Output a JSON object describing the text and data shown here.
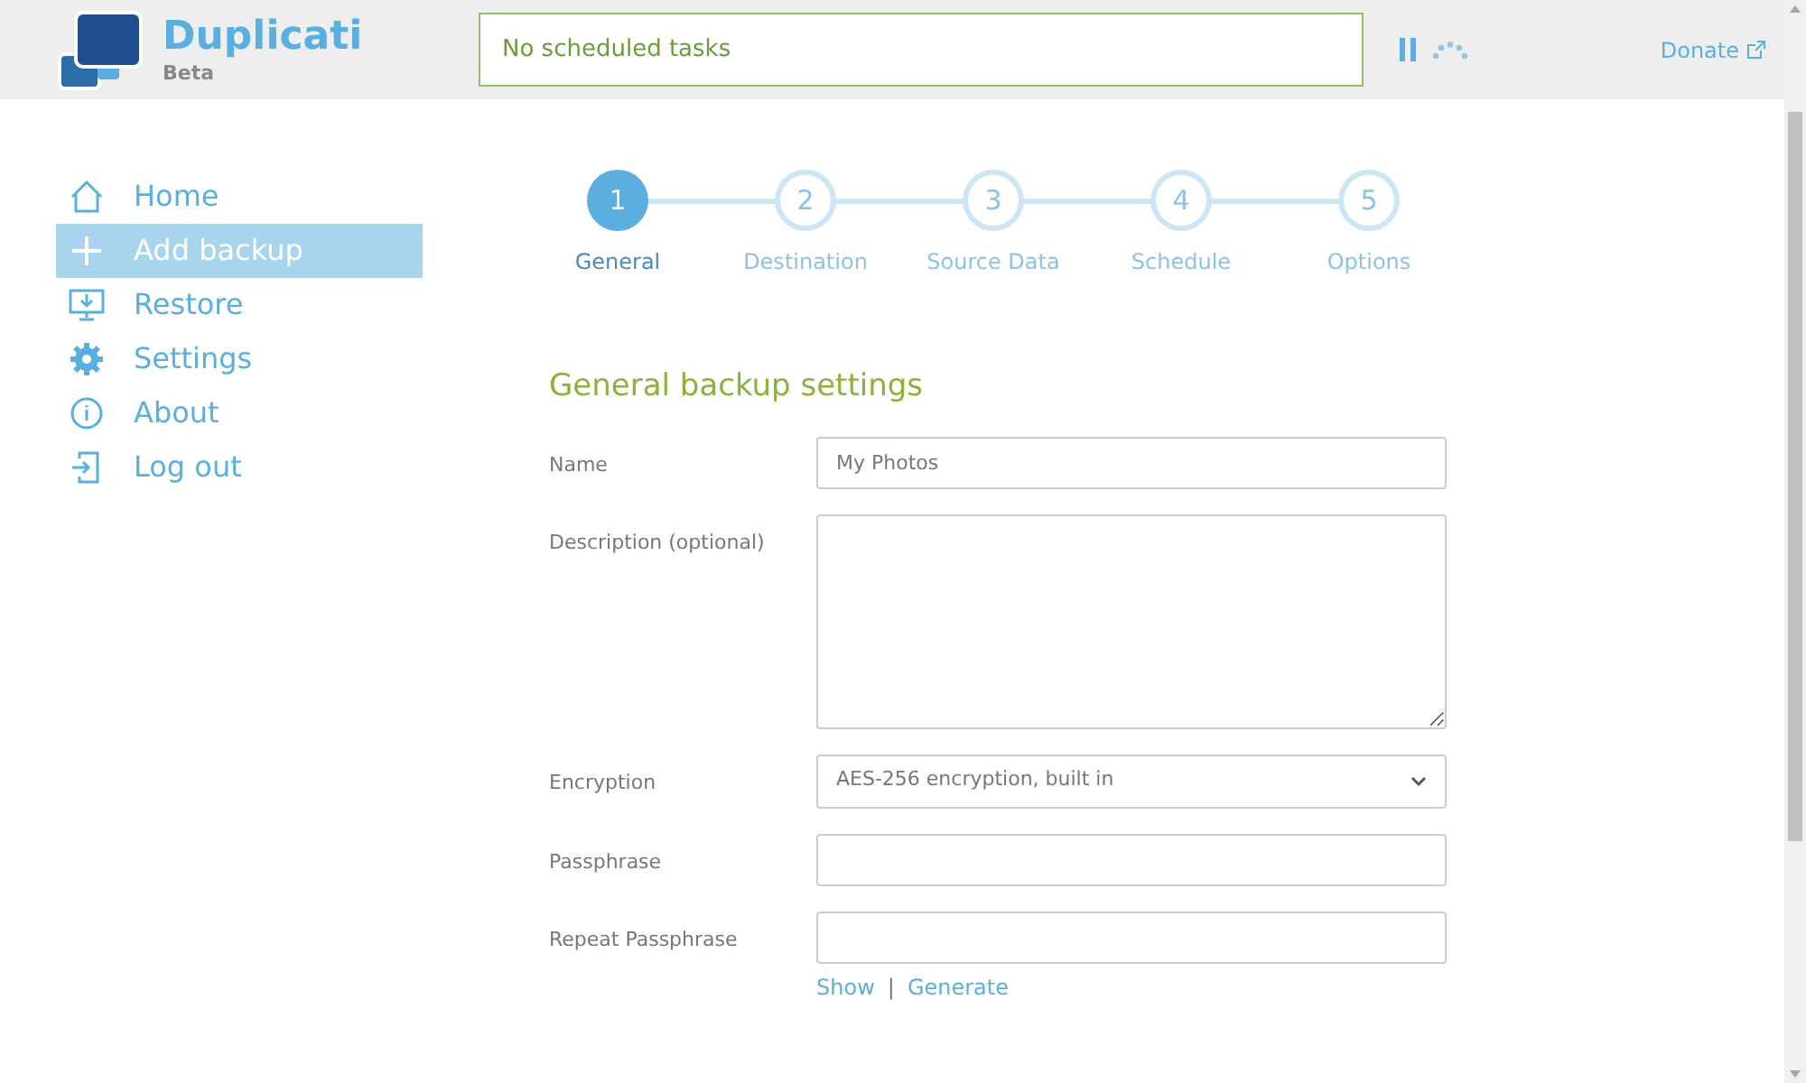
{
  "header": {
    "app_name": "Duplicati",
    "edition": "Beta",
    "status": "No scheduled tasks",
    "donate": "Donate"
  },
  "sidebar": {
    "items": [
      {
        "label": "Home",
        "kind": "home",
        "selected": false
      },
      {
        "label": "Add backup",
        "kind": "add",
        "selected": true
      },
      {
        "label": "Restore",
        "kind": "restore",
        "selected": false
      },
      {
        "label": "Settings",
        "kind": "settings",
        "selected": false
      },
      {
        "label": "About",
        "kind": "about",
        "selected": false
      },
      {
        "label": "Log out",
        "kind": "logout",
        "selected": false
      }
    ]
  },
  "steps": [
    {
      "number": "1",
      "label": "General",
      "selected": true
    },
    {
      "number": "2",
      "label": "Destination",
      "selected": false
    },
    {
      "number": "3",
      "label": "Source Data",
      "selected": false
    },
    {
      "number": "4",
      "label": "Schedule",
      "selected": false
    },
    {
      "number": "5",
      "label": "Options",
      "selected": false
    }
  ],
  "form": {
    "title": "General backup settings",
    "fields": [
      {
        "kind": "text",
        "label": "Name",
        "value": "My Photos"
      },
      {
        "kind": "textarea",
        "label": "Description (optional)"
      },
      {
        "kind": "select",
        "label": "Encryption",
        "value": "AES-256 encryption, built in"
      },
      {
        "kind": "password",
        "label": "Passphrase"
      },
      {
        "kind": "password",
        "label": "Repeat Passphrase"
      }
    ],
    "links": [
      "Show",
      "Generate"
    ],
    "separator": "|"
  }
}
